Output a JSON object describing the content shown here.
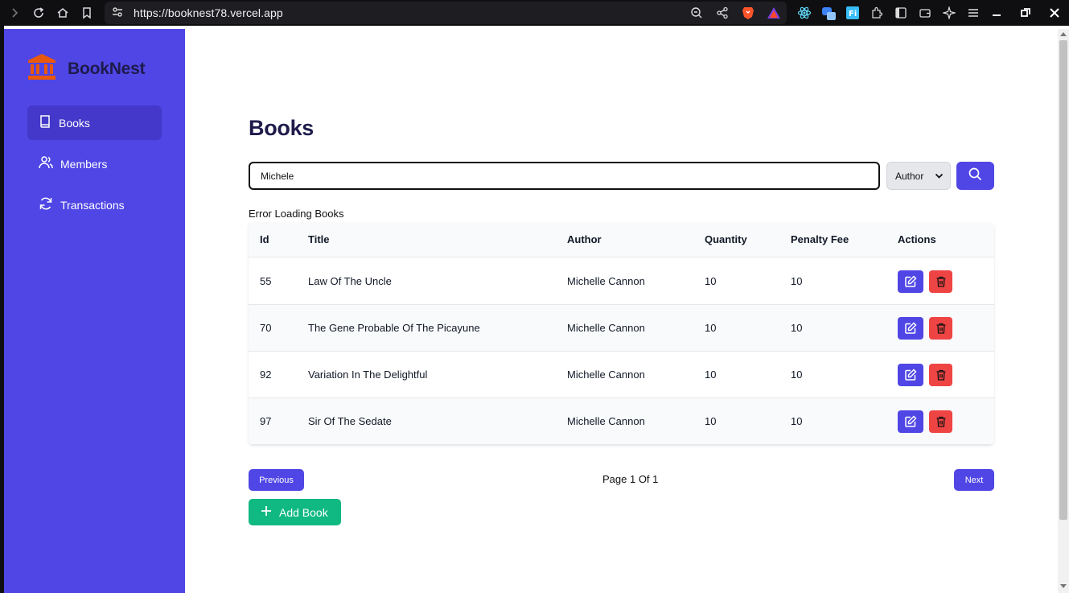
{
  "browser": {
    "url": "https://booknest78.vercel.app"
  },
  "sidebar": {
    "brand": "BookNest",
    "items": [
      {
        "label": "Books",
        "icon": "book-icon",
        "active": true
      },
      {
        "label": "Members",
        "icon": "users-icon",
        "active": false
      },
      {
        "label": "Transactions",
        "icon": "refresh-icon",
        "active": false
      }
    ]
  },
  "main": {
    "title": "Books",
    "search": {
      "value": "Michele"
    },
    "filter": {
      "selected": "Author"
    },
    "error": "Error Loading Books",
    "table": {
      "columns": [
        "Id",
        "Title",
        "Author",
        "Quantity",
        "Penalty Fee",
        "Actions"
      ],
      "rows": [
        {
          "id": "55",
          "title": "Law Of The Uncle",
          "author": "Michelle Cannon",
          "quantity": "10",
          "penalty_fee": "10"
        },
        {
          "id": "70",
          "title": "The Gene Probable Of The Picayune",
          "author": "Michelle Cannon",
          "quantity": "10",
          "penalty_fee": "10"
        },
        {
          "id": "92",
          "title": "Variation In The Delightful",
          "author": "Michelle Cannon",
          "quantity": "10",
          "penalty_fee": "10"
        },
        {
          "id": "97",
          "title": "Sir Of The Sedate",
          "author": "Michelle Cannon",
          "quantity": "10",
          "penalty_fee": "10"
        }
      ]
    },
    "pagination": {
      "previous": "Previous",
      "info": "Page 1 Of 1",
      "next": "Next"
    },
    "add_button": "Add Book"
  },
  "colors": {
    "primary": "#4f46e5",
    "sidebar_active": "#4338ca",
    "brand_icon": "#ea580c",
    "brand_text": "#1e1b4b",
    "danger": "#ef4444",
    "success": "#10b981"
  }
}
